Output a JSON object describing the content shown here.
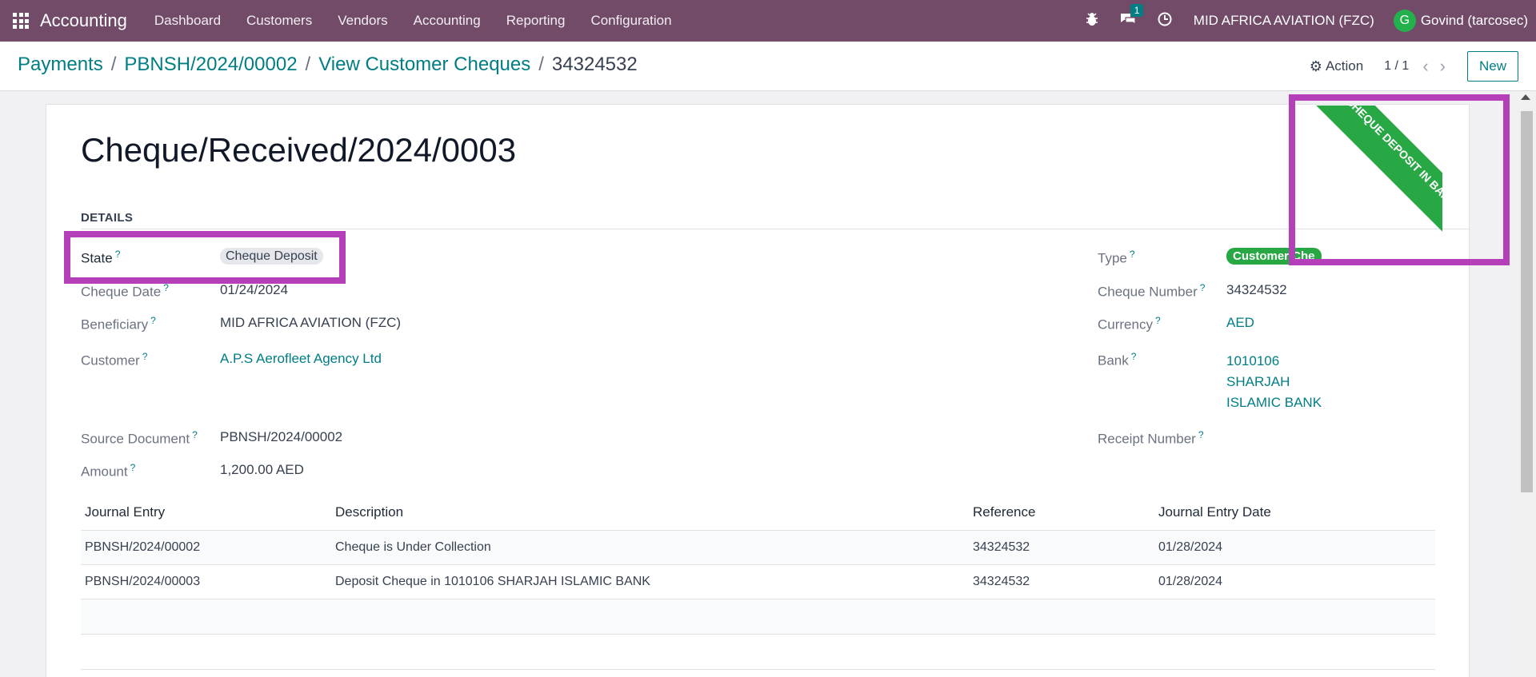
{
  "navbar": {
    "brand": "Accounting",
    "menu": [
      "Dashboard",
      "Customers",
      "Vendors",
      "Accounting",
      "Reporting",
      "Configuration"
    ],
    "messages_badge": "1",
    "company": "MID AFRICA AVIATION (FZC)",
    "avatar_initial": "G",
    "user": "Govind (tarcosec)"
  },
  "breadcrumb": {
    "items": [
      "Payments",
      "PBNSH/2024/00002",
      "View Customer Cheques"
    ],
    "current": "34324532"
  },
  "control": {
    "action_label": "Action",
    "pager": "1 / 1",
    "new_label": "New"
  },
  "record": {
    "title": "Cheque/Received/2024/0003",
    "section": "DETAILS",
    "ribbon": "CHEQUE DEPOSIT IN BANK",
    "left_fields": {
      "state": {
        "label": "State",
        "value": "Cheque Deposit"
      },
      "cheque_date": {
        "label": "Cheque Date",
        "value": "01/24/2024"
      },
      "beneficiary": {
        "label": "Beneficiary",
        "value": "MID AFRICA AVIATION (FZC)"
      },
      "customer": {
        "label": "Customer",
        "value": "A.P.S Aerofleet Agency Ltd"
      },
      "source_document": {
        "label": "Source Document",
        "value": "PBNSH/2024/00002"
      },
      "amount": {
        "label": "Amount",
        "value": "1,200.00 AED"
      }
    },
    "right_fields": {
      "type": {
        "label": "Type",
        "value": "Customer Che"
      },
      "cheque_number": {
        "label": "Cheque Number",
        "value": "34324532"
      },
      "currency": {
        "label": "Currency",
        "value": "AED"
      },
      "bank": {
        "label": "Bank",
        "lines": [
          "1010106",
          "SHARJAH",
          "ISLAMIC BANK"
        ]
      },
      "receipt_number": {
        "label": "Receipt Number",
        "value": ""
      }
    }
  },
  "journal_table": {
    "columns": [
      "Journal Entry",
      "Description",
      "Reference",
      "Journal Entry Date"
    ],
    "rows": [
      [
        "PBNSH/2024/00002",
        "Cheque is Under Collection",
        "34324532",
        "01/28/2024"
      ],
      [
        "PBNSH/2024/00003",
        "Deposit Cheque in 1010106 SHARJAH ISLAMIC BANK",
        "34324532",
        "01/28/2024"
      ]
    ]
  },
  "colors": {
    "navbar": "#714b67",
    "link": "#017e84",
    "ribbon": "#28a745",
    "highlight": "#b43fb9"
  }
}
